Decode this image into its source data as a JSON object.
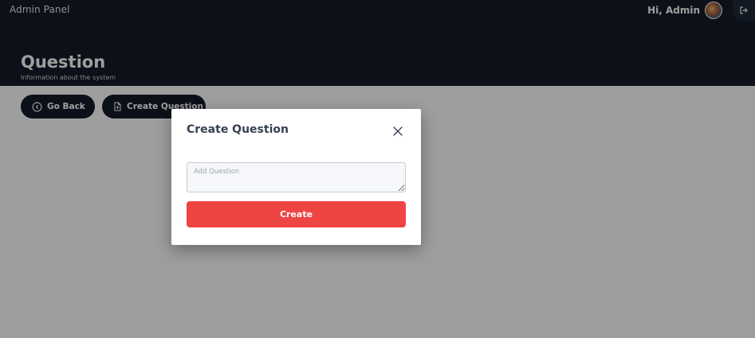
{
  "header": {
    "brand": "Admin Panel",
    "greeting": "Hi, Admin",
    "page_title": "Question",
    "page_subtitle": "Information about the system"
  },
  "toolbar": {
    "back_label": "Go Back",
    "create_label": "Create Question"
  },
  "modal": {
    "title": "Create Question",
    "textarea_placeholder": "Add Question",
    "textarea_value": "",
    "submit_label": "Create"
  },
  "icons": {
    "avatar": "avatar-photo",
    "logout": "logout-icon",
    "back": "circle-chevron-left-icon",
    "create": "file-icon",
    "close": "close-icon"
  },
  "colors": {
    "header_bg": "#141c29",
    "accent": "#ef4444",
    "overlay": "rgba(0,0,0,0.38)"
  }
}
